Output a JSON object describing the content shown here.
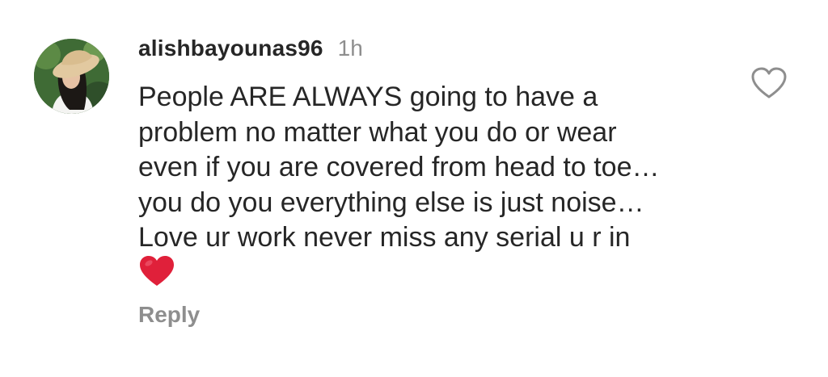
{
  "comment": {
    "username": "alishbayounas96",
    "timestamp": "1h",
    "text": "People ARE  ALWAYS going to have a\nproblem no matter what you do or wear\neven if you are covered from head to toe…\nyou do you everything else is just noise…\nLove ur work never miss any serial u r in",
    "emoji": "red-heart-emoji",
    "reply_label": "Reply",
    "like_icon": "heart-outline-icon",
    "avatar": "profile-avatar"
  },
  "colors": {
    "text": "#262626",
    "muted": "#8e8e8e",
    "heart": "#e0203a"
  }
}
